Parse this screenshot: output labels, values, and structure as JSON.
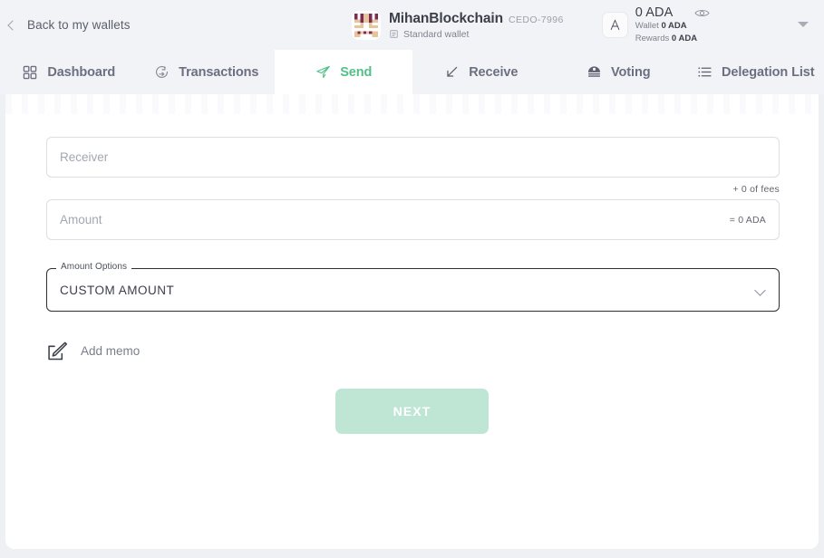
{
  "header": {
    "back_label": "Back to my wallets",
    "back_icon": "chevron-left-icon",
    "avatar_icon": "wallet-identicon-avatar",
    "wallet_name": "MihanBlockchain",
    "wallet_code": "CEDO-7996",
    "wallet_type": "Standard wallet",
    "wallet_type_icon": "document-icon",
    "ada_symbol_icon": "ada-symbol-icon",
    "balance_total": "0 ADA",
    "balance_wallet_label": "Wallet",
    "balance_wallet_value": "0 ADA",
    "balance_rewards_label": "Rewards",
    "balance_rewards_value": "0 ADA",
    "eye_icon": "eye-icon",
    "caret_icon": "caret-down-icon"
  },
  "tabs": [
    {
      "label": "Dashboard",
      "icon": "grid-icon",
      "active": false
    },
    {
      "label": "Transactions",
      "icon": "exchange-icon",
      "active": false
    },
    {
      "label": "Send",
      "icon": "paper-plane-icon",
      "active": true
    },
    {
      "label": "Receive",
      "icon": "arrow-down-left-icon",
      "active": false
    },
    {
      "label": "Voting",
      "icon": "ballot-box-icon",
      "active": false
    },
    {
      "label": "Delegation List",
      "icon": "list-icon",
      "active": false
    }
  ],
  "form": {
    "receiver_placeholder": "Receiver",
    "receiver_value": "",
    "fees_hint": "+ 0 of fees",
    "amount_placeholder": "Amount",
    "amount_value": "",
    "amount_equivalent": "= 0 ADA",
    "amount_options_legend": "Amount Options",
    "amount_options_value": "CUSTOM AMOUNT",
    "amount_options_caret": "chevron-down-icon",
    "memo_icon": "pencil-edit-icon",
    "memo_label": "Add memo",
    "next_label": "NEXT"
  },
  "colors": {
    "accent_green": "#53c08a",
    "next_button": "#bfe6d4",
    "page_bg": "#eef0f3",
    "bar_bg": "#f2f3f6",
    "card_bg": "#ffffff",
    "text_primary": "#3b3f4a",
    "text_muted": "#a3a7b2"
  }
}
